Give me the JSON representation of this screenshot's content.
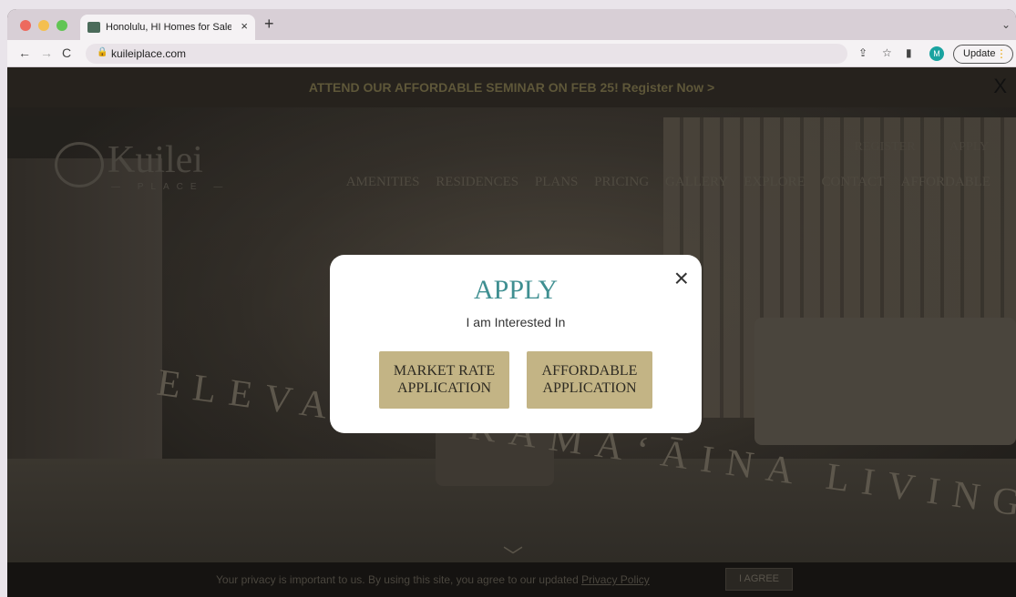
{
  "browser": {
    "tab_title": "Honolulu, HI Homes for Sale | K",
    "tab_close": "×",
    "new_tab": "+",
    "tab_menu": "⌄",
    "back": "←",
    "forward": "→",
    "reload": "C",
    "lock": "🔒",
    "url": "kuileiplace.com",
    "share": "⇪",
    "star": "☆",
    "side_panel": "▮",
    "profile_initial": "M",
    "update_label": "Update",
    "update_menu": "⋮"
  },
  "site": {
    "announcement": "ATTEND OUR AFFORDABLE SEMINAR ON FEB 25!  Register Now >",
    "announcement_close": "X",
    "logo_word": "Kuilei",
    "logo_sub": "— PLACE —",
    "util_nav": [
      "REGISTER",
      "APPLY"
    ],
    "main_nav": [
      "AMENITIES",
      "RESIDENCES",
      "PLANS",
      "PRICING",
      "GALLERY",
      "EXPLORE",
      "CONTACT",
      "AFFORDABLE"
    ],
    "tagline": "ELEVATED KAMAʻĀINA LIVING",
    "scroll_down": "﹀"
  },
  "privacy": {
    "text": "Your privacy is important to us. By using this site, you agree to our updated ",
    "link": "Privacy Policy",
    "agree": "I AGREE"
  },
  "modal": {
    "title": "APPLY",
    "subtitle": "I am Interested In",
    "close": "×",
    "buttons": {
      "market_line1": "MARKET RATE",
      "market_line2": "APPLICATION",
      "afford_line1": "AFFORDABLE",
      "afford_line2": "APPLICATION"
    }
  },
  "colors": {
    "modal_title": "#3f8f91",
    "button_bg": "#c3b485",
    "profile": "#1aa3a0"
  }
}
